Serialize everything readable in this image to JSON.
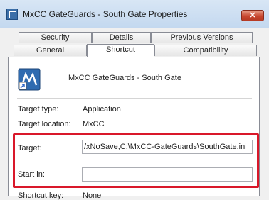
{
  "window": {
    "title": "MxCC GateGuards - South Gate Properties",
    "close_label": "✕"
  },
  "tabs_row1": [
    "Security",
    "Details",
    "Previous Versions"
  ],
  "tabs_row2": [
    "General",
    "Shortcut",
    "Compatibility"
  ],
  "active_tab": "Shortcut",
  "shortcut": {
    "name": "MxCC GateGuards - South Gate",
    "target_type_label": "Target type:",
    "target_type_value": "Application",
    "target_location_label": "Target location:",
    "target_location_value": "MxCC",
    "target_label": "Target:",
    "target_value": "/xNoSave,C:\\MxCC-GateGuards\\SouthGate.ini",
    "start_in_label": "Start in:",
    "start_in_value": "",
    "shortcut_key_label": "Shortcut key:",
    "shortcut_key_value": "None"
  },
  "colors": {
    "highlight": "#d9182a",
    "close_button": "#c8472f"
  }
}
